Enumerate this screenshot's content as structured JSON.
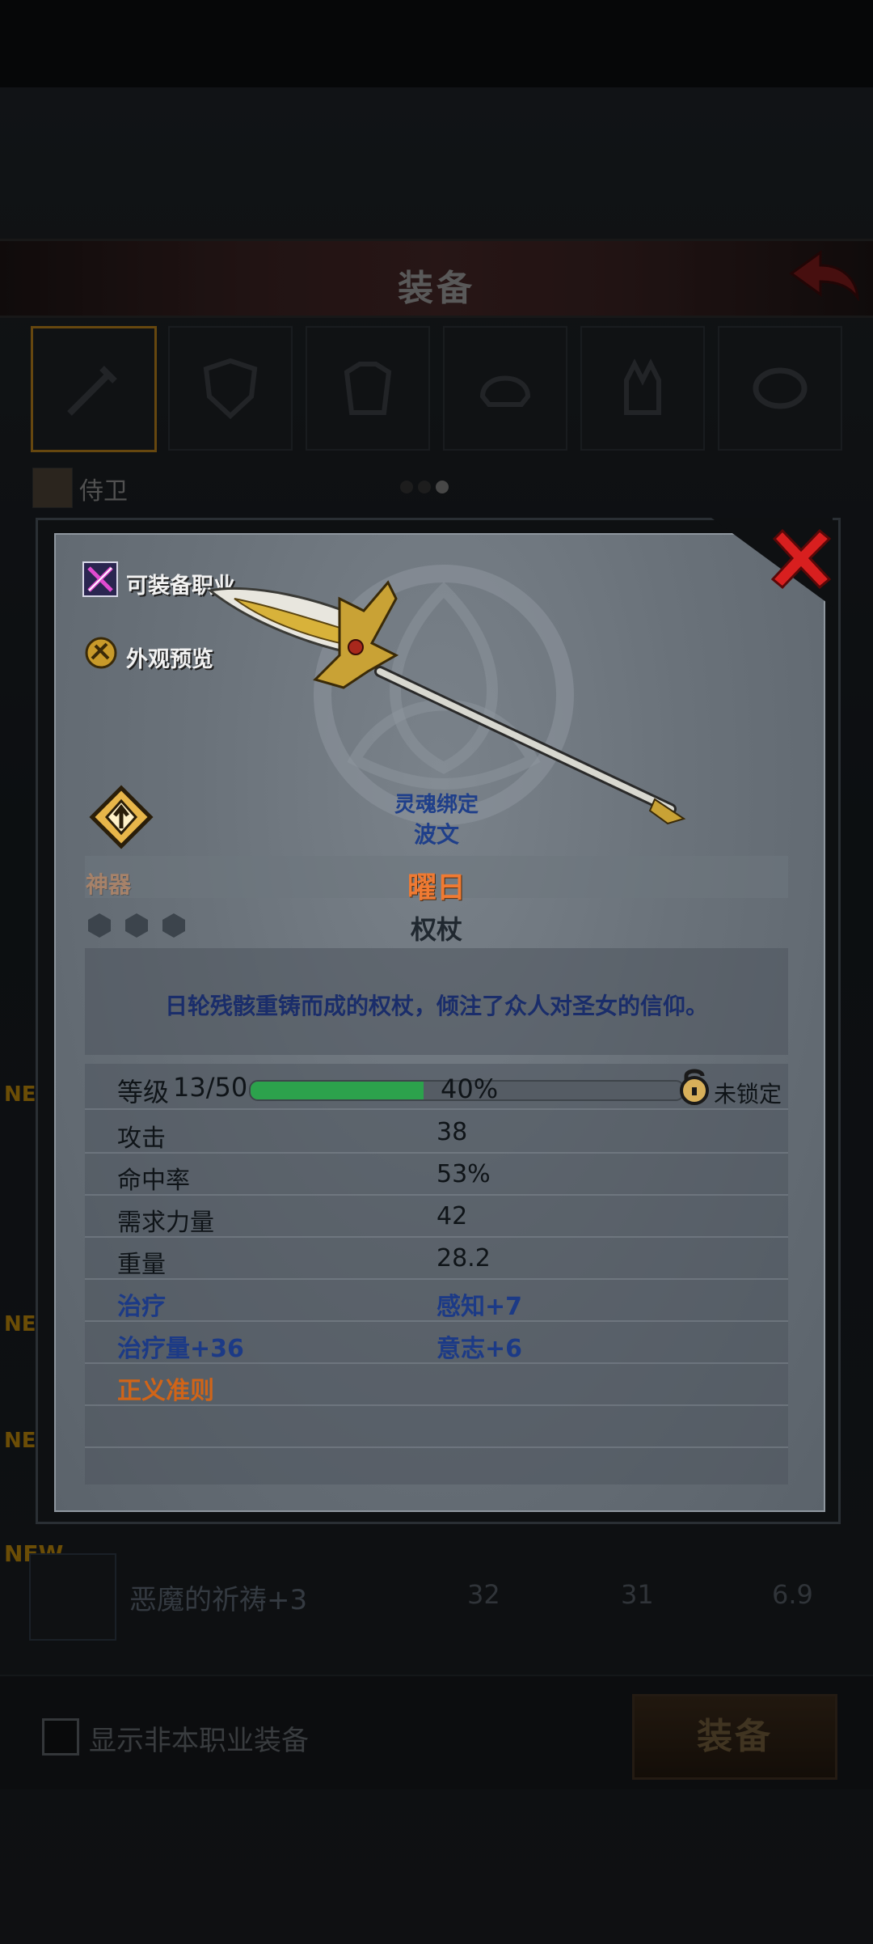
{
  "header": {
    "title": "装备"
  },
  "character": {
    "name": "侍卫"
  },
  "new_tag": "NEW",
  "background_item": {
    "name": "恶魔的祈祷+3",
    "stats": [
      "32",
      "31",
      "6.9"
    ]
  },
  "footer": {
    "show_non_class_label": "显示非本职业装备",
    "equip_button": "装备"
  },
  "detail": {
    "equippable_class_label": "可装备职业",
    "appearance_preview_label": "外观预览",
    "rarity": "神器",
    "soulbind": {
      "line1": "灵魂绑定",
      "line2": "波文"
    },
    "item_name": "曜日",
    "item_type": "权杖",
    "description": "日轮残骸重铸而成的权杖，倾注了众人对圣女的信仰。",
    "level": {
      "label": "等级",
      "value": "13/50",
      "progress_percent": 40,
      "progress_text": "40%"
    },
    "lock_status": "未锁定",
    "stats": [
      {
        "label": "攻击",
        "value": "38"
      },
      {
        "label": "命中率",
        "value": "53%"
      },
      {
        "label": "需求力量",
        "value": "42"
      },
      {
        "label": "重量",
        "value": "28.2"
      },
      {
        "label": "治疗",
        "value": "感知+7"
      },
      {
        "label": "治疗量+36",
        "value": "意志+6"
      },
      {
        "label": "正义准则",
        "value": ""
      }
    ]
  },
  "colors": {
    "rarity_orange": "#ee9050",
    "name_orange": "#f07a32",
    "enchant_blue": "#1c3a86",
    "progress_green": "#2ca24c",
    "close_red": "#d81f1f"
  },
  "icons": [
    "back-arrow-icon",
    "close-icon",
    "class-icon",
    "appearance-icon",
    "artifact-upgrade-icon",
    "lock-icon",
    "gem-slot-icon"
  ]
}
